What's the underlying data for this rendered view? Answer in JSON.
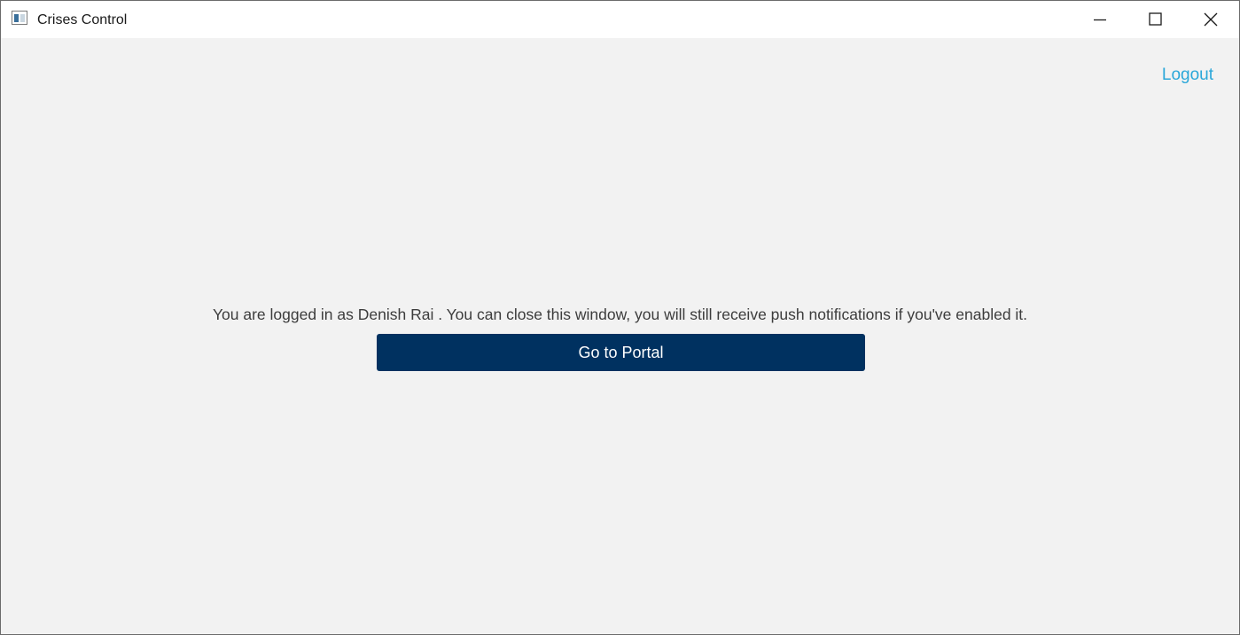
{
  "window": {
    "title": "Crises Control",
    "app_icon": "app-window-icon",
    "controls": {
      "minimize": "minimize-icon",
      "maximize": "maximize-icon",
      "close": "close-icon"
    }
  },
  "header": {
    "logout_label": "Logout"
  },
  "main": {
    "message": "You are logged in as Denish Rai . You can close this window, you will still receive push notifications if you've enabled it.",
    "portal_button_label": "Go to Portal"
  },
  "colors": {
    "background": "#f2f2f2",
    "titlebar": "#ffffff",
    "link": "#2aa7d9",
    "button": "#003160",
    "button_text": "#ffffff",
    "text": "#3c3c3c"
  }
}
